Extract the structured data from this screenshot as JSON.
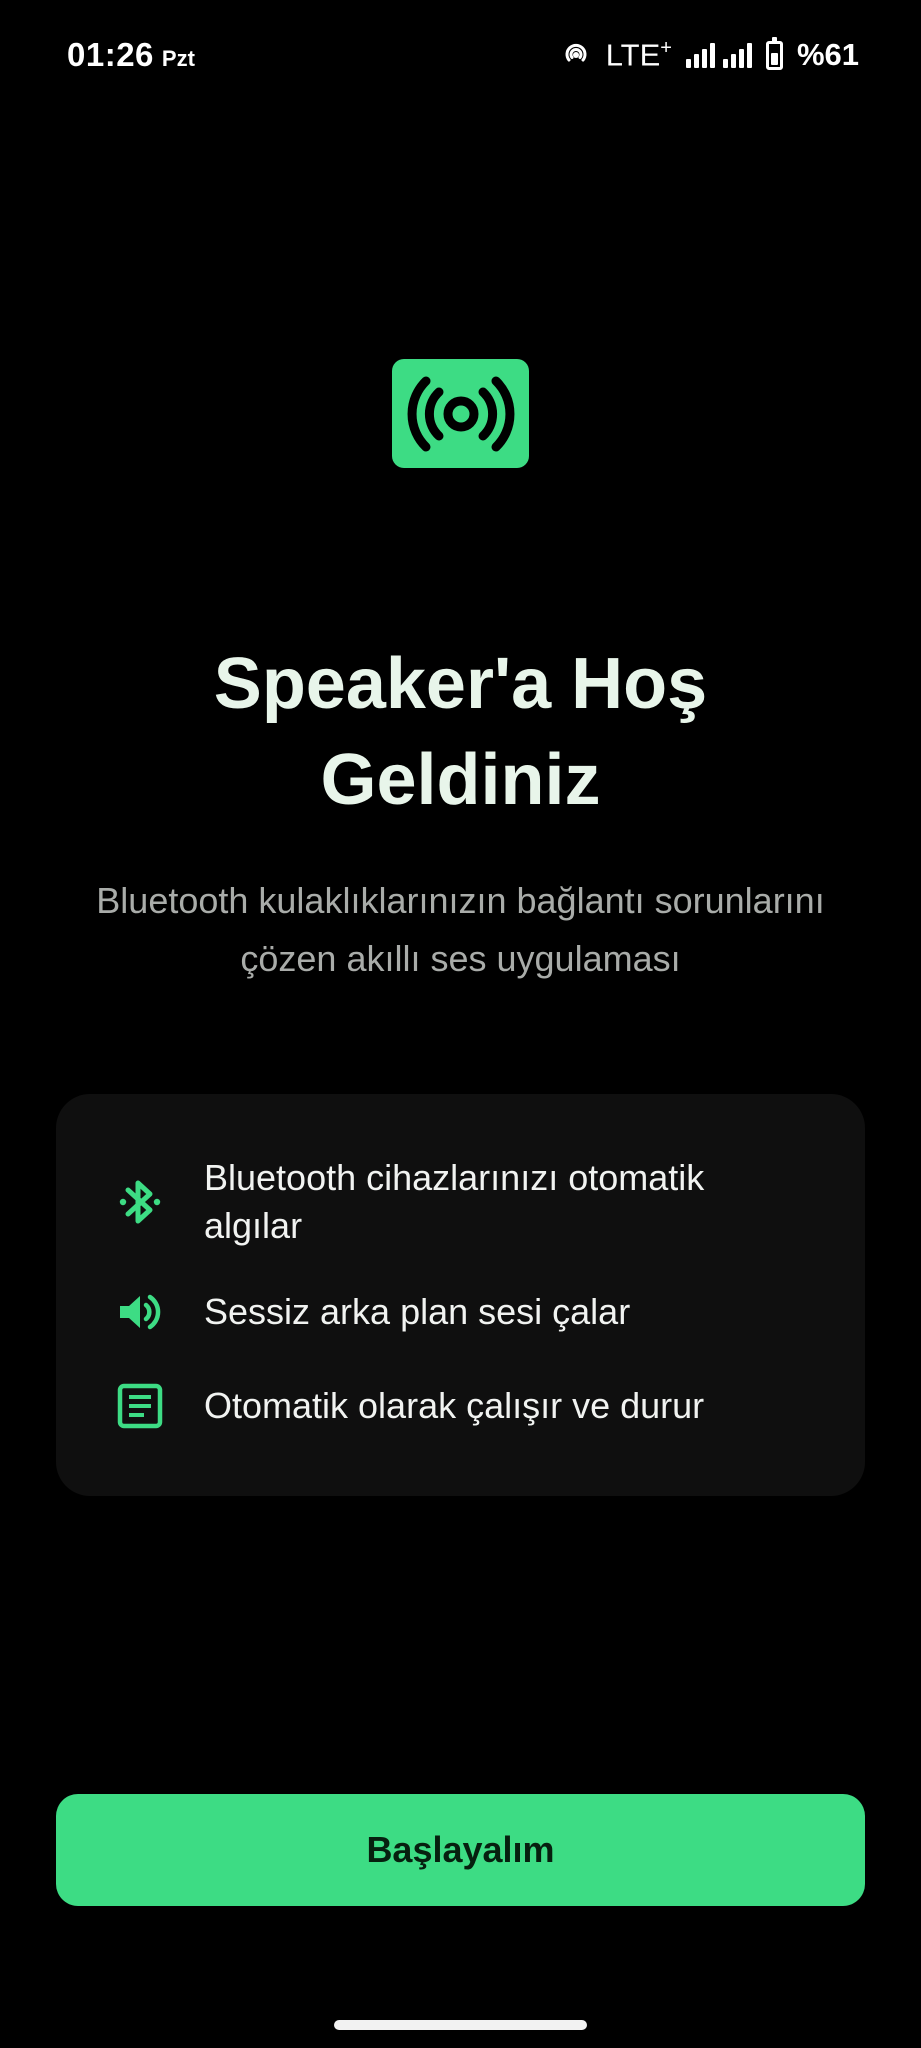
{
  "status_bar": {
    "time": "01:26",
    "day": "Pzt",
    "network": "LTE",
    "network_plus": "+",
    "battery_text": "%61",
    "battery_level": 0.61
  },
  "welcome": {
    "title_line1": "Speaker'a Hoş",
    "title_line2": "Geldiniz",
    "subtitle_line1": "Bluetooth kulaklıklarınızın bağlantı sorunlarını",
    "subtitle_line2": "çözen akıllı ses uygulaması"
  },
  "features": [
    {
      "icon": "bluetooth-searching-icon",
      "text_line1": "Bluetooth cihazlarınızı otomatik",
      "text_line2": "algılar"
    },
    {
      "icon": "volume-icon",
      "text_line1": "Sessiz arka plan sesi çalar",
      "text_line2": ""
    },
    {
      "icon": "article-icon",
      "text_line1": "Otomatik olarak çalışır ve durur",
      "text_line2": ""
    }
  ],
  "cta": {
    "label": "Başlayalım"
  },
  "colors": {
    "accent": "#3ddc84",
    "background": "#000000",
    "card": "#0f0f0f",
    "title": "#e8f5ea",
    "subtitle": "#a9aca9",
    "button_text": "#06200f"
  }
}
